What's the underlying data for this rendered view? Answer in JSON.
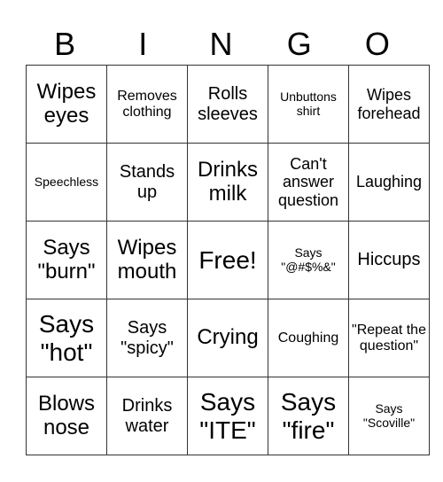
{
  "header": [
    "B",
    "I",
    "N",
    "G",
    "O"
  ],
  "cells": [
    [
      "Wipes eyes",
      "Removes clothing",
      "Rolls sleeves",
      "Unbuttons shirt",
      "Wipes forehead"
    ],
    [
      "Speechless",
      "Stands up",
      "Drinks milk",
      "Can't answer question",
      "Laughing"
    ],
    [
      "Says \"burn\"",
      "Wipes mouth",
      "Free!",
      "Says \"@#$%&\"",
      "Hiccups"
    ],
    [
      "Says \"hot\"",
      "Says \"spicy\"",
      "Crying",
      "Coughing",
      "\"Repeat the question\""
    ],
    [
      "Blows nose",
      "Drinks water",
      "Says \"ITE\"",
      "Says \"fire\"",
      "Says \"Scoville\""
    ]
  ]
}
